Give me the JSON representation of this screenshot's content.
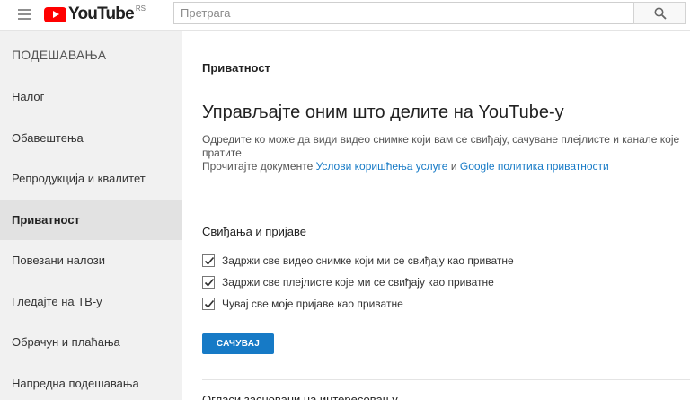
{
  "header": {
    "logo_text": "YouTube",
    "country_code": "RS",
    "search_placeholder": "Претрага"
  },
  "sidebar": {
    "title": "ПОДЕШАВАЊА",
    "items": [
      {
        "label": "Налог",
        "active": false
      },
      {
        "label": "Обавештења",
        "active": false
      },
      {
        "label": "Репродукција и квалитет",
        "active": false
      },
      {
        "label": "Приватност",
        "active": true
      },
      {
        "label": "Повезани налози",
        "active": false
      },
      {
        "label": "Гледајте на ТВ-у",
        "active": false
      },
      {
        "label": "Обрачун и плаћања",
        "active": false
      },
      {
        "label": "Напредна подешавања",
        "active": false
      }
    ]
  },
  "main": {
    "section_title": "Приватност",
    "heading": "Управљајте оним што делите на YouTube-у",
    "description": "Одредите ко може да види видео снимке који вам се свиђају, сачуване плејлисте и канале које пратите",
    "docs_prefix": "Прочитајте документе",
    "terms_link": "Услови коришћења услуге",
    "docs_and": "и",
    "privacy_link": "Google политика приватности",
    "likes_title": "Свиђања и пријаве",
    "checkboxes": [
      {
        "label": "Задржи све видео снимке који ми се свиђају као приватне",
        "checked": true
      },
      {
        "label": "Задржи све плејлисте које ми се свиђају као приватне",
        "checked": true
      },
      {
        "label": "Чувај све моје пријаве као приватне",
        "checked": true
      }
    ],
    "save_label": "САЧУВАЈ",
    "next_section_partial": "Огласи засновани на интересовању"
  },
  "colors": {
    "accent": "#167ac6",
    "logo_red": "#ff0000"
  }
}
